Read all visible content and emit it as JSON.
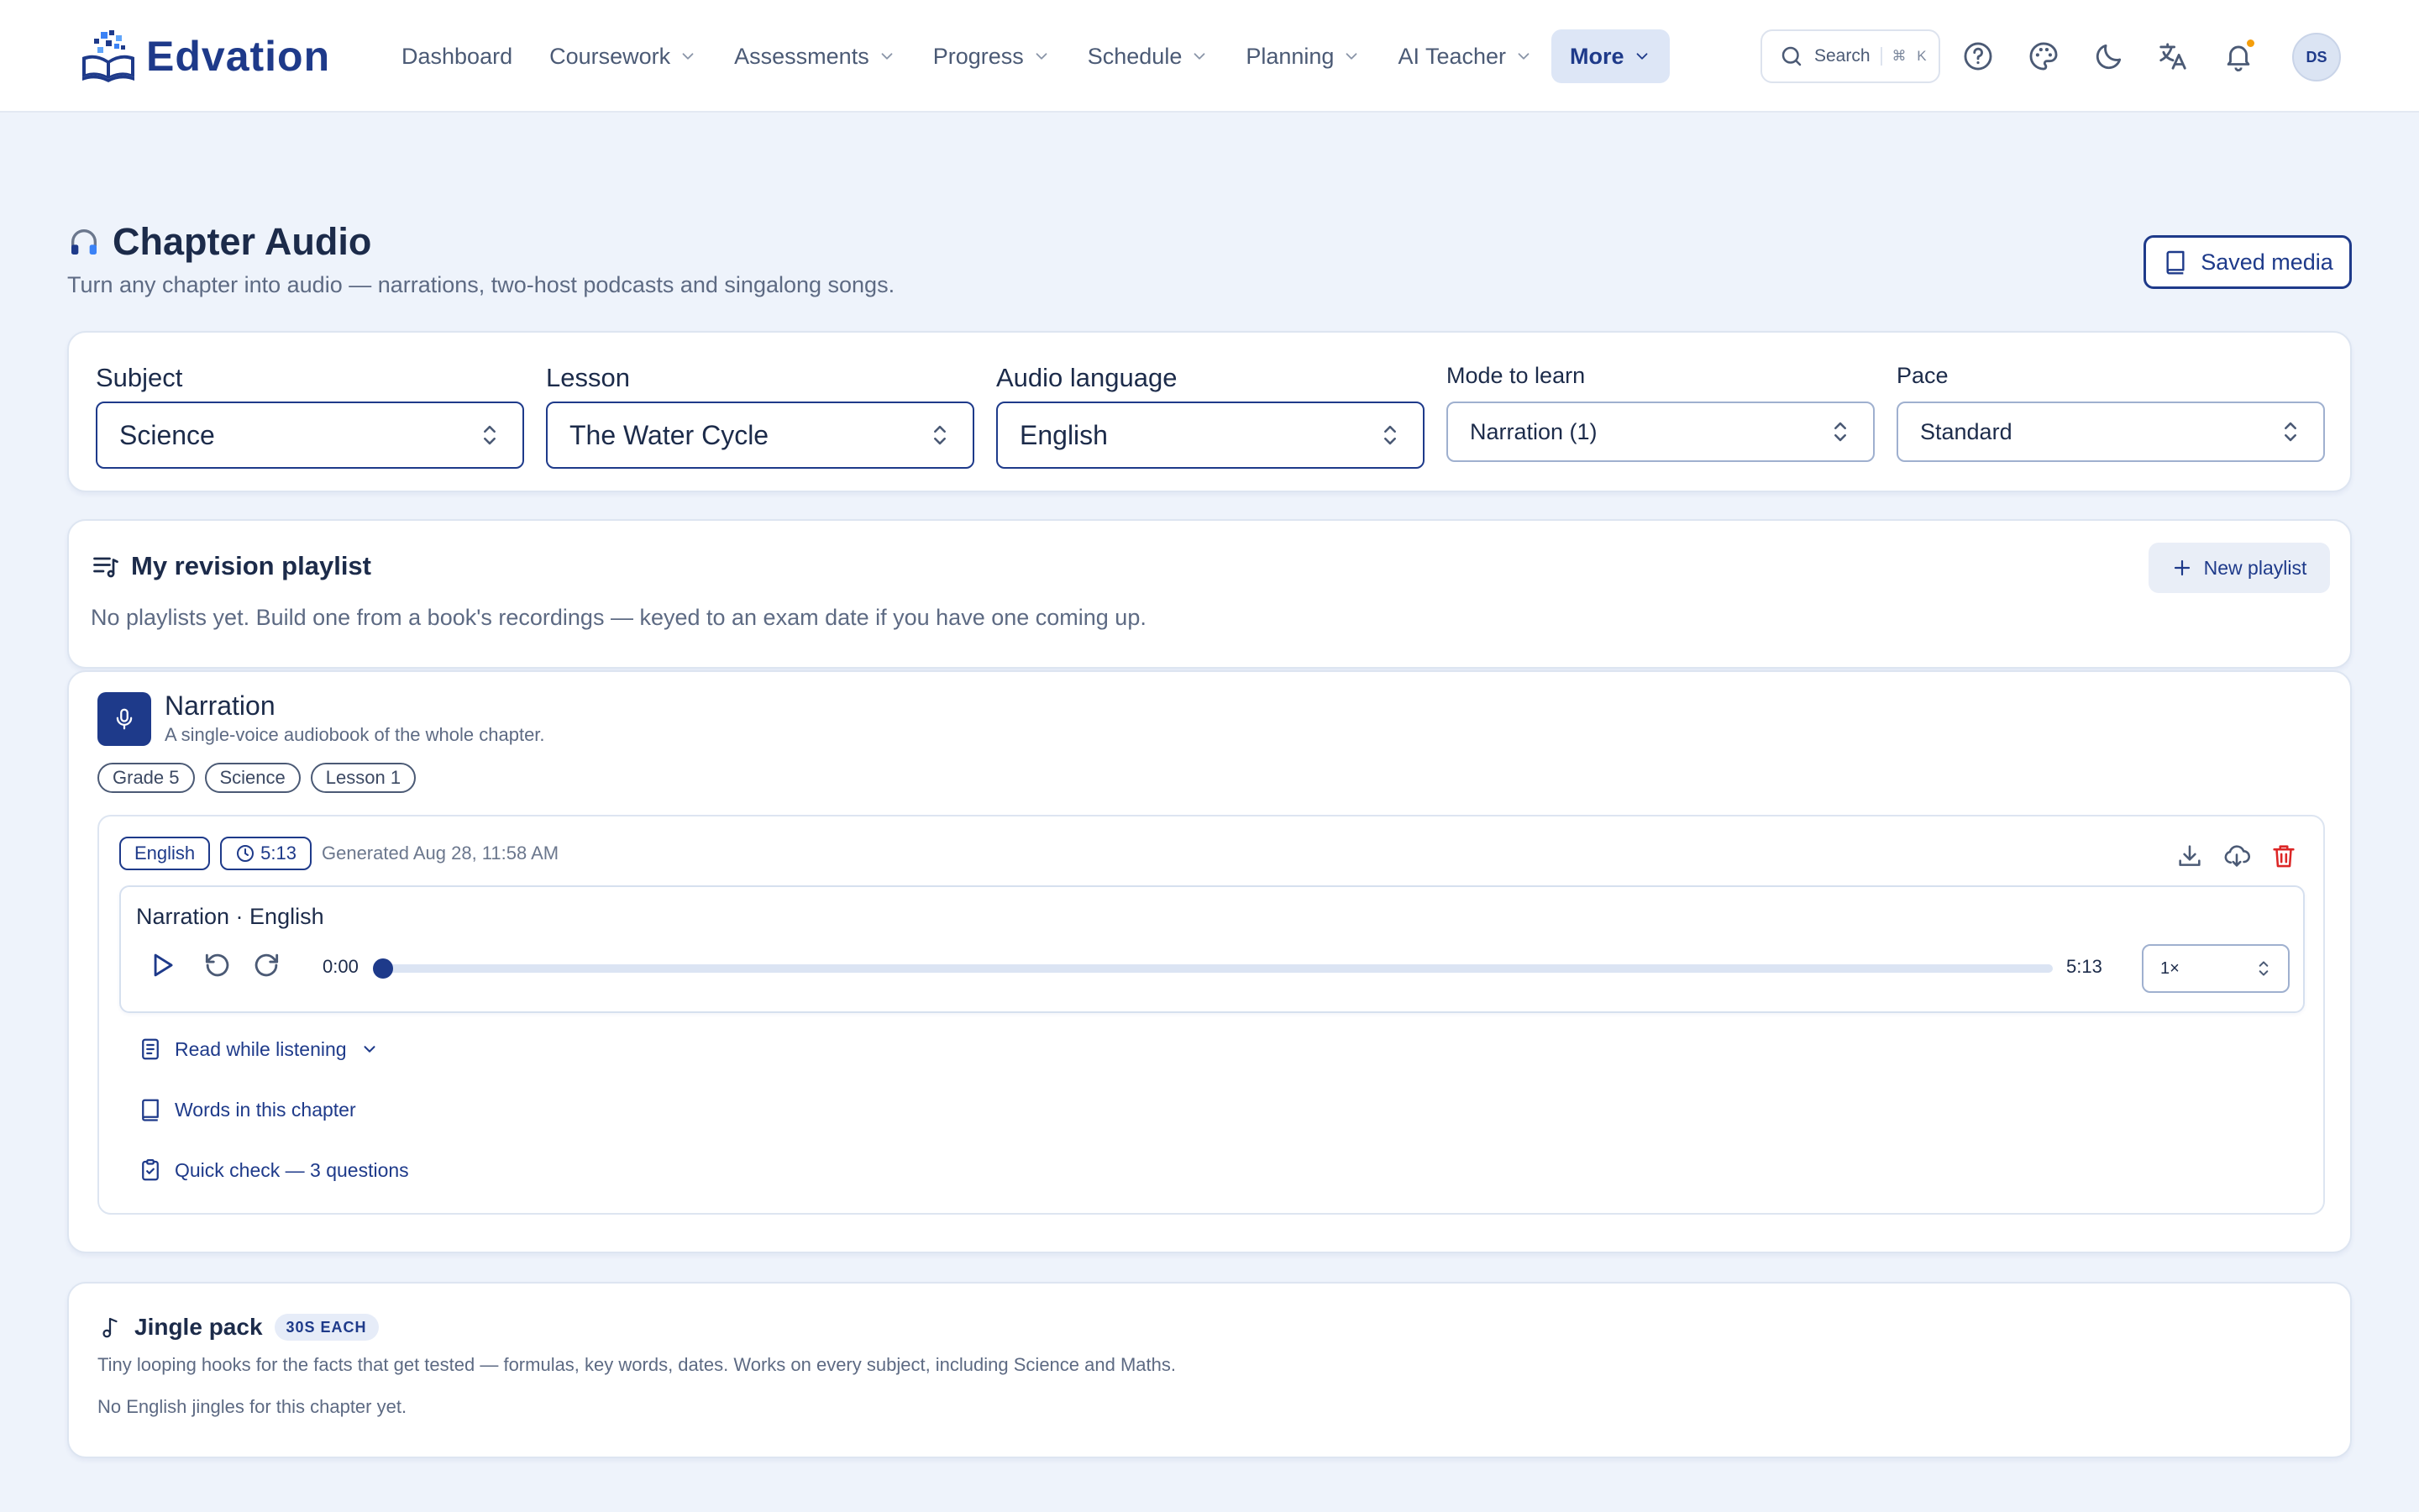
{
  "colors": {
    "accent": "#1e3a8a",
    "background": "#eef3fb",
    "danger": "#dc2626",
    "notification": "#f59e0b"
  },
  "header": {
    "brand": "Edvation",
    "nav": [
      {
        "label": "Dashboard",
        "has_menu": false
      },
      {
        "label": "Coursework",
        "has_menu": true
      },
      {
        "label": "Assessments",
        "has_menu": true
      },
      {
        "label": "Progress",
        "has_menu": true
      },
      {
        "label": "Schedule",
        "has_menu": true
      },
      {
        "label": "Planning",
        "has_menu": true
      },
      {
        "label": "AI Teacher",
        "has_menu": true
      },
      {
        "label": "More",
        "has_menu": true,
        "active": true
      }
    ],
    "search": {
      "label": "Search",
      "shortcut": "⌘ K"
    },
    "icons": [
      "help-icon",
      "palette-icon",
      "moon-icon",
      "translate-icon",
      "bell-icon"
    ],
    "avatar_initials": "DS"
  },
  "page": {
    "title": "Chapter Audio",
    "title_icon": "headphones-icon",
    "subtitle": "Turn any chapter into audio — narrations, two-host podcasts and singalong songs.",
    "saved_media_label": "Saved media"
  },
  "filters": {
    "subject": {
      "label": "Subject",
      "value": "Science"
    },
    "lesson": {
      "label": "Lesson",
      "value": "The Water Cycle"
    },
    "language": {
      "label": "Audio language",
      "value": "English"
    },
    "mode": {
      "label": "Mode to learn",
      "value": "Narration (1)"
    },
    "pace": {
      "label": "Pace",
      "value": "Standard"
    }
  },
  "playlist": {
    "title": "My revision playlist",
    "empty_text": "No playlists yet. Build one from a book's recordings — keyed to an exam date if you have one coming up.",
    "new_label": "New playlist"
  },
  "narration": {
    "title": "Narration",
    "subtitle": "A single-voice audiobook of the whole chapter.",
    "tags": [
      "Grade 5",
      "Science",
      "Lesson 1"
    ],
    "recording": {
      "language": "English",
      "duration": "5:13",
      "generated": "Generated Aug 28, 11:58 AM",
      "player_title": "Narration · English",
      "current_time": "0:00",
      "total_time": "5:13",
      "progress": 0,
      "speed": "1×",
      "links": {
        "read": "Read while listening",
        "words": "Words in this chapter",
        "quiz": "Quick check — 3 questions"
      }
    }
  },
  "jingle": {
    "title": "Jingle pack",
    "badge": "30S EACH",
    "description": "Tiny looping hooks for the facts that get tested — formulas, key words, dates. Works on every subject, including Science and Maths.",
    "empty_text": "No English jingles for this chapter yet."
  }
}
